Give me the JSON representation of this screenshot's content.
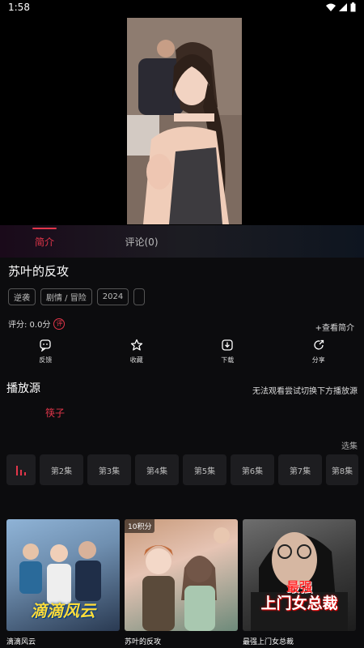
{
  "status": {
    "time": "1:58"
  },
  "tabs": [
    {
      "label": "简介"
    },
    {
      "label": "评论(0)"
    }
  ],
  "drama": {
    "title": "苏叶的反攻",
    "tags": [
      "逆袭",
      "剧情 / 冒险",
      "2024",
      ""
    ],
    "rating_label": "评分: 0.0分",
    "rating_badge": "评",
    "more_intro": "+查看简介"
  },
  "actions": [
    {
      "icon": "feedback-icon",
      "label": "反馈"
    },
    {
      "icon": "star-icon",
      "label": "收藏"
    },
    {
      "icon": "download-icon",
      "label": "下载"
    },
    {
      "icon": "share-icon",
      "label": "分享"
    }
  ],
  "source": {
    "title": "播放源",
    "hint": "无法观看尝试切换下方播放源",
    "selected": "筷子"
  },
  "episodes": {
    "select_label": "选集",
    "items": [
      "第2集",
      "第3集",
      "第4集",
      "第5集",
      "第6集",
      "第7集",
      "第8集"
    ]
  },
  "recommendations": [
    {
      "title": "滴滴风云",
      "poster_text": "滴滴风云",
      "badge": ""
    },
    {
      "title": "苏叶的反攻",
      "poster_text": "",
      "badge": "10积分"
    },
    {
      "title": "最强上门女总裁",
      "poster_text": "上门女总裁",
      "poster_top_text": "最强",
      "badge": ""
    }
  ],
  "colors": {
    "accent": "#e3364a",
    "background": "#0c0c0e"
  }
}
